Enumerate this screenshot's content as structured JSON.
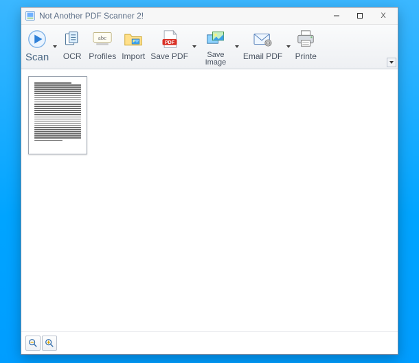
{
  "window": {
    "title": "Not Another PDF Scanner 2!",
    "controls": {
      "minimize": "—",
      "maximize": "☐",
      "close": "X"
    }
  },
  "toolbar": {
    "scan": {
      "label": "Scan"
    },
    "ocr": {
      "label": "OCR"
    },
    "profiles": {
      "label": "Profiles"
    },
    "import": {
      "label": "Import"
    },
    "save_pdf": {
      "label": "Save PDF"
    },
    "save_image": {
      "label": "Save\nImage"
    },
    "email_pdf": {
      "label": "Email PDF"
    },
    "printer": {
      "label": "Printe"
    }
  },
  "content": {
    "pages": [
      {
        "kind": "text-document"
      }
    ]
  },
  "footer": {
    "zoom_out": "−",
    "zoom_in": "+"
  }
}
